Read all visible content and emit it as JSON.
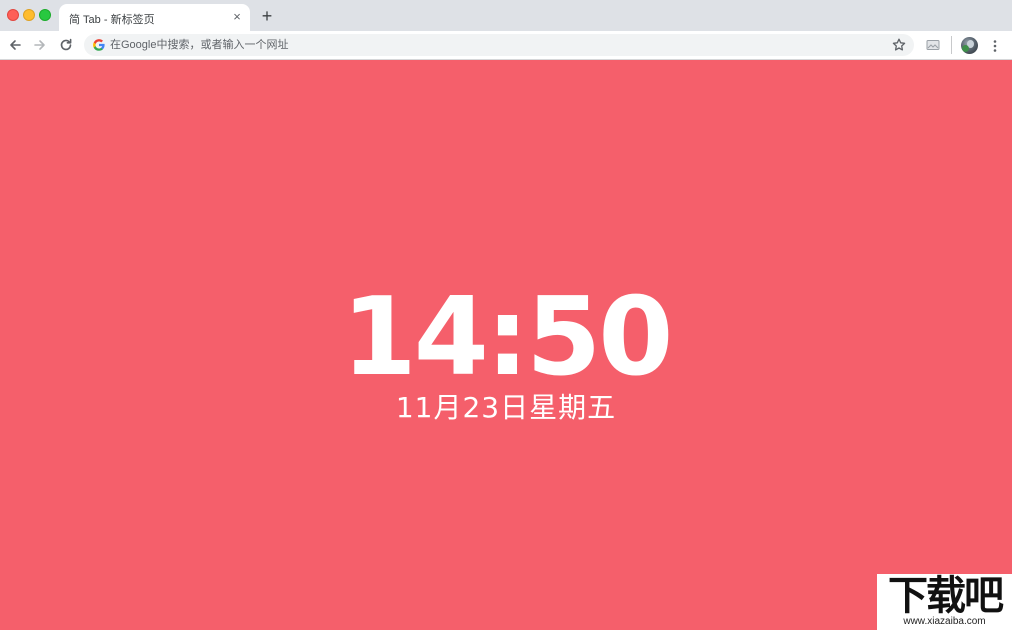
{
  "browser": {
    "tab": {
      "title": "简 Tab - 新标签页",
      "close_glyph": "×"
    },
    "new_tab_glyph": "+",
    "omnibox": {
      "placeholder": "在Google中搜索，或者输入一个网址",
      "value": ""
    },
    "colors": {
      "tabstrip": "#dee1e6",
      "toolbar": "#ffffff",
      "omnibox": "#f1f3f4"
    }
  },
  "page": {
    "time": "14:50",
    "date": "11月23日星期五",
    "colors": {
      "background": "#f55f6b",
      "text": "#ffffff"
    }
  },
  "watermark": {
    "logo_text": "下载吧",
    "url": "www.xiazaiba.com"
  }
}
